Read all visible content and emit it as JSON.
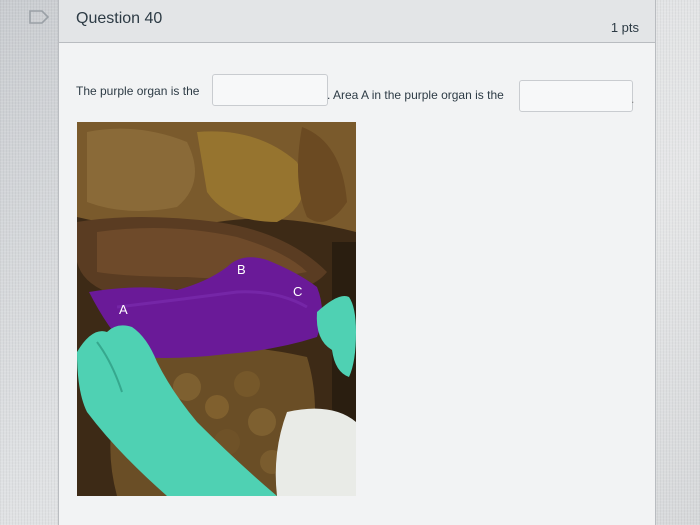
{
  "question": {
    "title": "Question 40",
    "points": "1 pts",
    "text_part1": "The purple organ is the",
    "text_part2": ". Area A in the purple organ is the",
    "text_part3": ".",
    "blank1_value": "",
    "blank2_value": ""
  },
  "image": {
    "labels": {
      "a": "A",
      "b": "B",
      "c": "C"
    },
    "highlight_color": "#6a1a98",
    "glove_color": "#4fd1b3"
  },
  "icons": {
    "flag": "flag-icon"
  }
}
